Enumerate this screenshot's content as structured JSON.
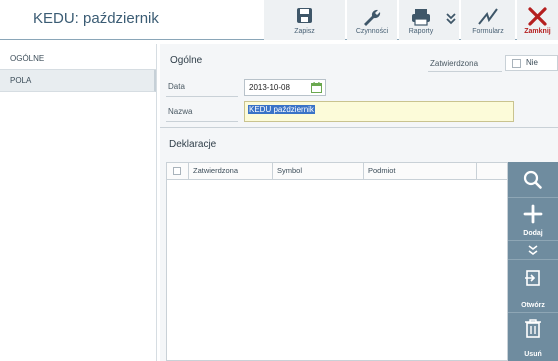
{
  "window": {
    "title": "KEDU: październik"
  },
  "toolbar": {
    "save_label": "Zapisz",
    "actions_label": "Czynności",
    "reports_label": "Raporty",
    "form_label": "Formularz",
    "close_label": "Zamknij"
  },
  "nav": {
    "items": [
      {
        "label": "OGÓLNE"
      },
      {
        "label": "POLA"
      }
    ]
  },
  "general": {
    "title": "Ogólne",
    "date_label": "Data",
    "date_value": "2013-10-08",
    "name_label": "Nazwa",
    "name_value": "KEDU październik",
    "approved_label": "Zatwierdzona",
    "approved_value": "Nie"
  },
  "declarations": {
    "title": "Deklaracje",
    "columns": [
      "Zatwierdzona",
      "Symbol",
      "Podmiot"
    ],
    "rows": []
  },
  "side_actions": {
    "add_label": "Dodaj",
    "open_label": "Otwórz",
    "delete_label": "Usuń"
  },
  "colors": {
    "accent": "#6f8c9f",
    "close": "#b51f1f",
    "title": "#3b5c74"
  }
}
